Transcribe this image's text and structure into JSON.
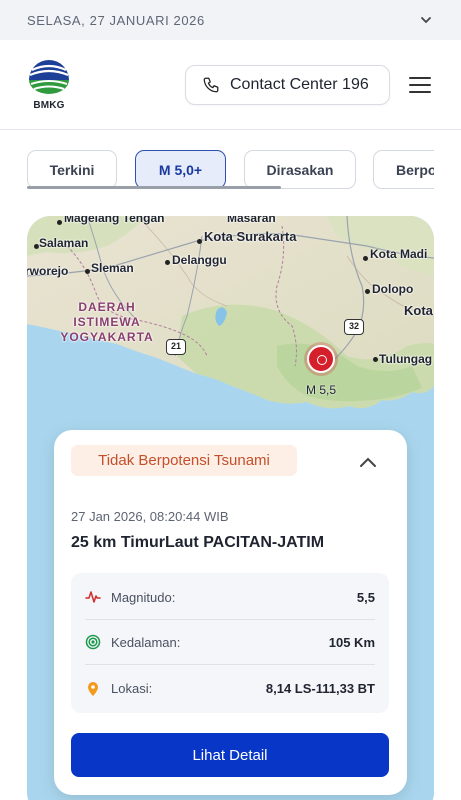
{
  "top_bar": {
    "date": "SELASA, 27 JANUARI 2026"
  },
  "header": {
    "logo_text": "BMKG",
    "contact_label": "Contact Center 196"
  },
  "tabs": [
    {
      "label": "Terkini",
      "active": false
    },
    {
      "label": "M 5,0+",
      "active": true
    },
    {
      "label": "Dirasakan",
      "active": false
    },
    {
      "label": "Berpo",
      "active": false
    }
  ],
  "map": {
    "labels": {
      "magelang": "Magelang Tengah",
      "masaran": "Masaran",
      "salaman": "Salaman",
      "kota_surakarta": "Kota Surakarta",
      "kota_madiun": "Kota Madi",
      "purworejo": "rworejo",
      "sleman": "Sleman",
      "delanggu": "Delanggu",
      "dolopo": "Dolopo",
      "kota_right": "Kota",
      "region_line1": "DAERAH",
      "region_line2": "ISTIMEWA",
      "region_line3": "YOGYAKARTA",
      "tulungagung": "Tulungag",
      "road_21": "21",
      "road_32": "32"
    },
    "epicenter_label": "M 5,5"
  },
  "event": {
    "tsunami_status": "Tidak Berpotensi Tsunami",
    "datetime": "27 Jan 2026, 08:20:44 WIB",
    "location_name": "25 km TimurLaut PACITAN-JATIM",
    "magnitude_label": "Magnitudo:",
    "magnitude_value": "5,5",
    "depth_label": "Kedalaman:",
    "depth_value": "105 Km",
    "location_label": "Lokasi:",
    "location_value": "8,14 LS-111,33 BT",
    "detail_button": "Lihat Detail"
  },
  "colors": {
    "accent": "#0836C7",
    "tsunami_bg": "#FDEEE6",
    "tsunami_text": "#C4502B",
    "epicenter": "#D51F2A"
  }
}
